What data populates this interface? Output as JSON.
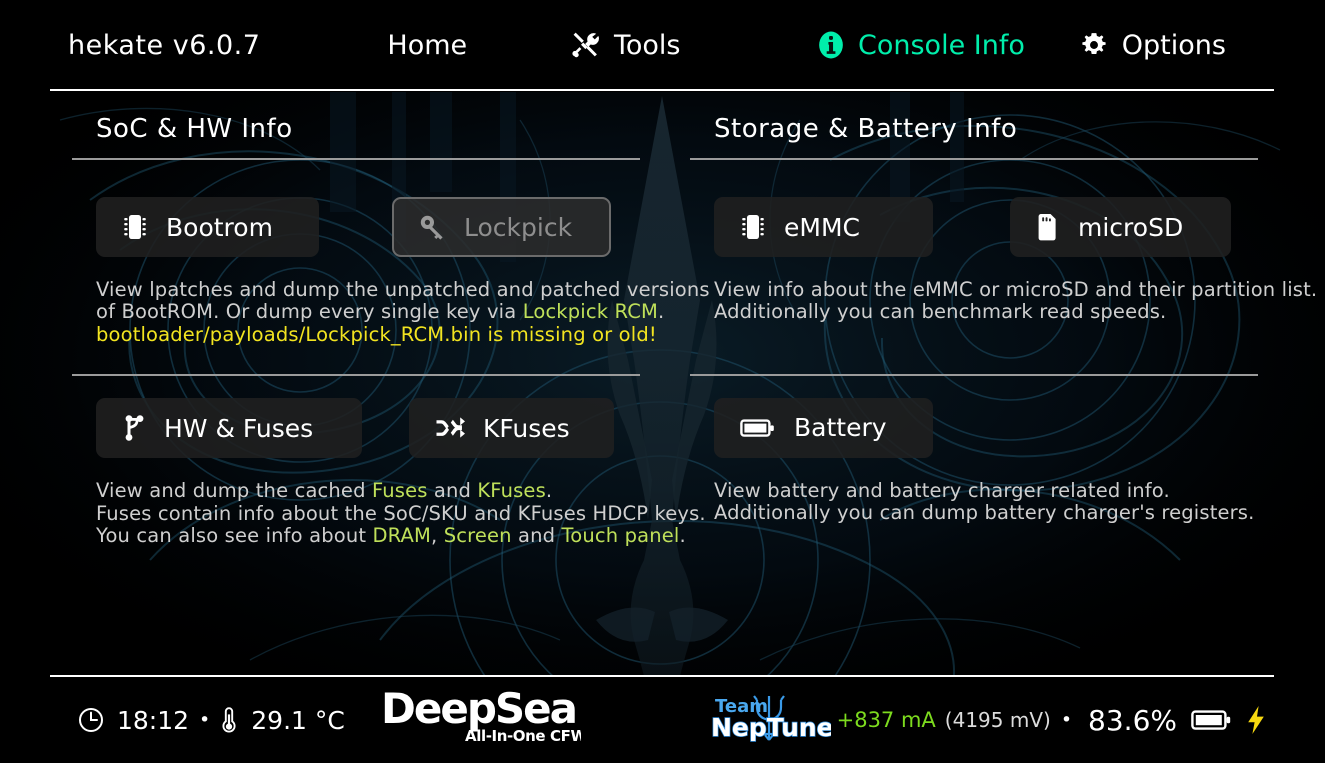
{
  "app": {
    "title": "hekate v6.0.7"
  },
  "nav": [
    {
      "id": "home",
      "label": "Home",
      "icon": "grid-icon",
      "active": false
    },
    {
      "id": "tools",
      "label": "Tools",
      "icon": "tools-icon",
      "active": false
    },
    {
      "id": "console",
      "label": "Console Info",
      "icon": "info-icon",
      "active": true
    },
    {
      "id": "options",
      "label": "Options",
      "icon": "gear-icon",
      "active": false
    }
  ],
  "colors": {
    "accent": "#00eeab",
    "link_green": "#bfe05a",
    "warning_yellow": "#f2e420",
    "current_green": "#7ddb1e",
    "neptune_blue": "#2f8fe0",
    "bolt_yellow": "#f7d910",
    "button_bg": "#202020",
    "rule": "#9b9b9b"
  },
  "sections": {
    "left": {
      "title": "SoC & HW Info",
      "row1": {
        "buttons": [
          {
            "id": "bootrom",
            "label": "Bootrom",
            "icon": "chip-icon",
            "disabled": false
          },
          {
            "id": "lockpick",
            "label": "Lockpick",
            "icon": "key-icon",
            "disabled": true
          }
        ],
        "desc": [
          {
            "parts": [
              {
                "t": "View lpatches and dump the unpatched and patched versions",
                "c": "n"
              }
            ]
          },
          {
            "parts": [
              {
                "t": "of BootROM. Or dump every single key via ",
                "c": "n"
              },
              {
                "t": "Lockpick RCM",
                "c": "g"
              },
              {
                "t": ".",
                "c": "n"
              }
            ]
          },
          {
            "parts": [
              {
                "t": "bootloader/payloads/Lockpick_RCM.bin is missing or old!",
                "c": "y"
              }
            ]
          }
        ]
      },
      "row2": {
        "buttons": [
          {
            "id": "hw-fuses",
            "label": "HW & Fuses",
            "icon": "branch-icon",
            "disabled": false
          },
          {
            "id": "kfuses",
            "label": "KFuses",
            "icon": "shuffle-icon",
            "disabled": false
          }
        ],
        "desc": [
          {
            "parts": [
              {
                "t": "View and dump the cached ",
                "c": "n"
              },
              {
                "t": "Fuses",
                "c": "g"
              },
              {
                "t": " and ",
                "c": "n"
              },
              {
                "t": "KFuses",
                "c": "g"
              },
              {
                "t": ".",
                "c": "n"
              }
            ]
          },
          {
            "parts": [
              {
                "t": "Fuses contain info about the SoC/SKU and KFuses HDCP keys.",
                "c": "n"
              }
            ]
          },
          {
            "parts": [
              {
                "t": "You can also see info about ",
                "c": "n"
              },
              {
                "t": "DRAM",
                "c": "g"
              },
              {
                "t": ", ",
                "c": "n"
              },
              {
                "t": "Screen",
                "c": "g"
              },
              {
                "t": " and ",
                "c": "n"
              },
              {
                "t": "Touch panel",
                "c": "g"
              },
              {
                "t": ".",
                "c": "n"
              }
            ]
          }
        ]
      }
    },
    "right": {
      "title": "Storage & Battery Info",
      "row1": {
        "buttons": [
          {
            "id": "emmc",
            "label": "eMMC",
            "icon": "chip-icon",
            "disabled": false
          },
          {
            "id": "microsd",
            "label": "microSD",
            "icon": "sd-icon",
            "disabled": false
          }
        ],
        "desc": [
          {
            "parts": [
              {
                "t": "View info about the eMMC or microSD and their partition list.",
                "c": "n"
              }
            ]
          },
          {
            "parts": [
              {
                "t": "Additionally you can benchmark read speeds.",
                "c": "n"
              }
            ]
          }
        ]
      },
      "row2": {
        "buttons": [
          {
            "id": "battery",
            "label": "Battery",
            "icon": "battery-icon",
            "disabled": false
          }
        ],
        "desc": [
          {
            "parts": [
              {
                "t": "View battery and battery charger related info.",
                "c": "n"
              }
            ]
          },
          {
            "parts": [
              {
                "t": "Additionally you can dump battery charger's registers.",
                "c": "n"
              }
            ]
          }
        ]
      }
    }
  },
  "footer": {
    "clock": "18:12",
    "separator": "•",
    "temperature": "29.1 °C",
    "brand": {
      "name": "DeepSea",
      "tagline": "All-In-One CFW"
    },
    "team": {
      "line1": "Team",
      "line2": "NepTune"
    },
    "current": "+837 mA",
    "voltage": "(4195 mV)",
    "battery_percent": "83.6%",
    "charging": true
  }
}
